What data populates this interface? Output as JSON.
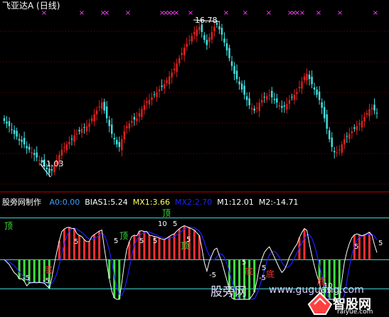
{
  "main_panel": {
    "title": "飞亚达A (日线)",
    "high_label": "16.78",
    "low_label": "11.03"
  },
  "indicator_panel": {
    "name": "股旁网制作",
    "readouts": [
      {
        "text": "A0:0.00",
        "color": "#40a0ff"
      },
      {
        "text": "BIAS1:5.24",
        "color": "#ffffff"
      },
      {
        "text": "MX1:3.66",
        "color": "#ffff60"
      },
      {
        "text": "MX2:2.70",
        "color": "#2020ff"
      },
      {
        "text": "M1:12.01",
        "color": "#ffffff"
      },
      {
        "text": "M2:-14.71",
        "color": "#ffffff"
      }
    ],
    "top_marks": [
      "顶",
      "顶",
      "顶",
      "顶"
    ],
    "bottom_marks": [
      "底",
      "底",
      "底",
      "底"
    ],
    "num_labels": [
      "5",
      "5",
      "5",
      "5",
      "5",
      "5",
      "5",
      "5",
      "5",
      "5",
      "10",
      "10",
      "-5",
      "-5",
      "-5",
      "-5",
      "-5"
    ]
  },
  "watermark": {
    "chinese": "股旁网",
    "url": "www.guguang.com",
    "logo_text": "智股网",
    "logo_url": "raiyue.com"
  },
  "colors": {
    "bg": "#000000",
    "up": "#e02020",
    "down": "#40e0e0",
    "grid": "#800000",
    "bias": "#ffffff",
    "mx2": "#2020ff",
    "green_bar": "#40e040",
    "red_bar": "#ff3030",
    "cross": "#ff40ff",
    "level_line": "#40e0e0"
  },
  "chart_data": {
    "type": "candlestick",
    "title": "飞亚达A (日线)",
    "price_high": 16.78,
    "price_low": 11.03,
    "price_range": [
      10.6,
      17.4
    ],
    "closes": [
      13.1,
      13.0,
      12.9,
      12.75,
      12.6,
      12.5,
      12.35,
      12.3,
      12.2,
      12.05,
      12.0,
      11.9,
      11.8,
      11.7,
      11.6,
      11.5,
      11.4,
      11.25,
      11.1,
      11.2,
      11.4,
      11.6,
      11.8,
      12.0,
      12.1,
      12.2,
      12.3,
      12.4,
      12.55,
      12.6,
      12.7,
      12.8,
      12.85,
      12.9,
      13.0,
      13.2,
      13.35,
      13.5,
      13.65,
      13.8,
      13.5,
      13.2,
      12.9,
      12.6,
      12.4,
      12.2,
      12.1,
      12.4,
      12.7,
      12.9,
      13.0,
      13.1,
      13.15,
      13.2,
      13.4,
      13.55,
      13.7,
      13.85,
      13.9,
      14.0,
      14.1,
      14.2,
      14.3,
      14.4,
      14.5,
      14.65,
      14.8,
      14.95,
      15.1,
      15.3,
      15.5,
      15.7,
      15.9,
      16.05,
      16.2,
      16.35,
      16.5,
      16.6,
      16.7,
      16.5,
      16.2,
      16.0,
      16.3,
      16.5,
      16.7,
      16.78,
      16.6,
      16.4,
      16.1,
      15.8,
      15.5,
      15.2,
      14.9,
      14.7,
      14.5,
      14.3,
      14.1,
      13.9,
      13.7,
      13.6,
      13.5,
      13.6,
      13.8,
      13.9,
      14.0,
      14.05,
      14.1,
      14.0,
      13.9,
      13.8,
      13.7,
      13.6,
      13.65,
      13.75,
      13.9,
      14.0,
      14.1,
      14.2,
      14.4,
      14.6,
      14.8,
      14.9,
      14.7,
      14.5,
      14.3,
      14.1,
      13.9,
      13.6,
      13.2,
      12.8,
      12.4,
      12.1,
      11.9,
      11.9,
      12.0,
      12.2,
      12.4,
      12.5,
      12.6,
      12.7,
      12.8,
      12.9,
      13.0,
      13.1,
      13.25,
      13.4,
      13.55,
      13.6,
      13.5,
      13.4
    ],
    "indicator": {
      "series": [
        "BIAS1",
        "MX1",
        "MX2"
      ],
      "values": {
        "A0": 0.0,
        "BIAS1": 5.24,
        "MX1": 3.66,
        "MX2": 2.7,
        "M1": 12.01,
        "M2": -14.71
      },
      "ylim": [
        -20,
        25
      ]
    }
  }
}
